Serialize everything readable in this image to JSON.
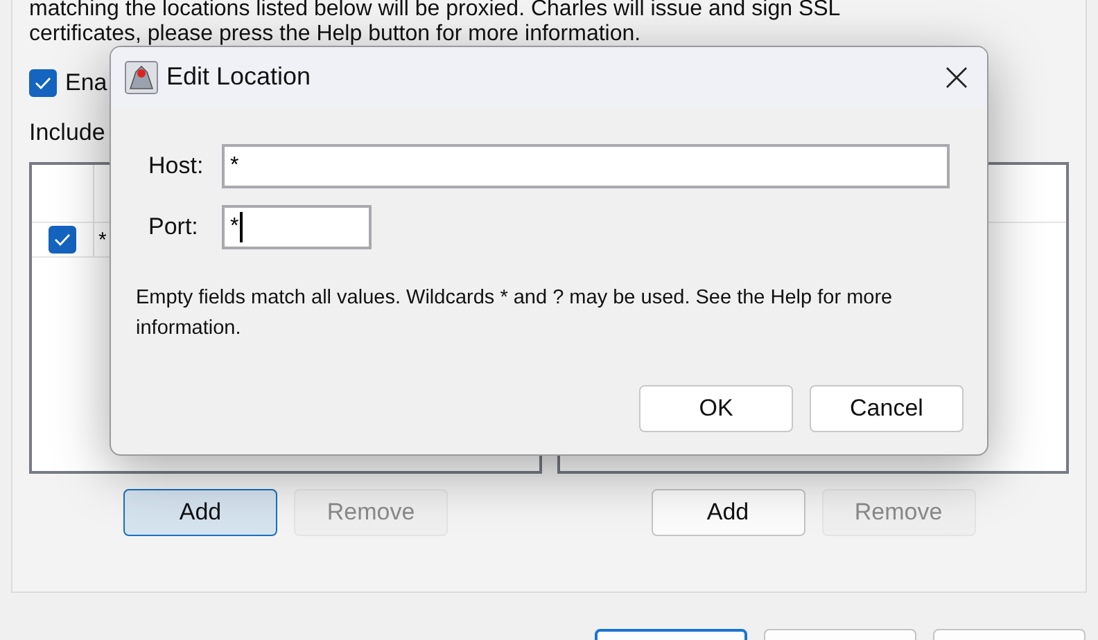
{
  "background": {
    "description_lines": [
      "matching the locations listed below will be proxied. Charles will issue and sign SSL",
      "certificates, please press the Help button for more information."
    ],
    "enable": {
      "label": "Ena",
      "checked": true
    },
    "include_label": "Include",
    "include_table": {
      "rows": [
        {
          "checked": true,
          "cell": "*"
        }
      ]
    },
    "include_buttons": [
      {
        "label": "Add",
        "focused": true,
        "disabled": false
      },
      {
        "label": "Remove",
        "focused": false,
        "disabled": true
      }
    ],
    "exclude_buttons": [
      {
        "label": "Add",
        "focused": false,
        "disabled": false
      },
      {
        "label": "Remove",
        "focused": false,
        "disabled": true
      }
    ],
    "bottom_buttons": [
      {
        "focused": true
      },
      {
        "focused": false
      },
      {
        "focused": false
      }
    ]
  },
  "dialog": {
    "title": "Edit Location",
    "fields": [
      {
        "label": "Host:",
        "value": "*",
        "focused": false,
        "wide": true
      },
      {
        "label": "Port:",
        "value": "*",
        "focused": true,
        "wide": false
      }
    ],
    "note": "Empty fields match all values. Wildcards * and ? may be used. See the Help for more information.",
    "buttons": [
      "OK",
      "Cancel"
    ]
  }
}
